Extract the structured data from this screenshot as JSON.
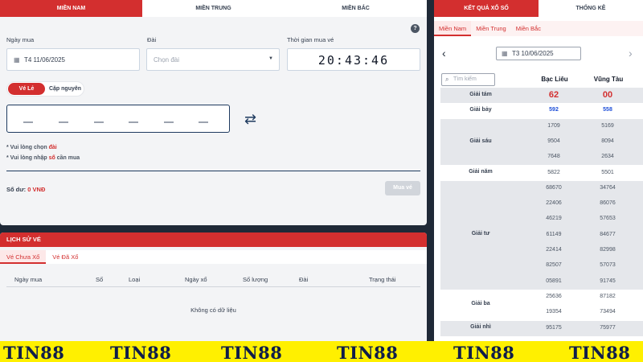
{
  "region_tabs": [
    "MIỀN NAM",
    "MIỀN TRUNG",
    "MIỀN BẮC"
  ],
  "form": {
    "date_label": "Ngày mua",
    "date_value": "T4 11/06/2025",
    "dai_label": "Đài",
    "dai_placeholder": "Chọn đài",
    "time_label": "Thời gian mua vé",
    "time_value": "20:43:46",
    "ticket_type_on": "Vé Lẻ",
    "ticket_type_off": "Cặp nguyên",
    "hint1_prefix": "* Vui lòng chọn ",
    "hint1_red": "đài",
    "hint2_prefix": "* Vui lòng nhập ",
    "hint2_red": "số",
    "hint2_suffix": " cần mua",
    "balance_label": "Số dư: ",
    "balance_value": "0 VNĐ",
    "buy_label": "Mua vé",
    "help": "?"
  },
  "history": {
    "title": "LỊCH SỬ VÉ",
    "tabs": [
      "Vé Chưa Xổ",
      "Vé Đã Xổ"
    ],
    "columns": [
      "Ngày mua",
      "Số",
      "Loại",
      "Ngày xổ",
      "Số lượng",
      "Đài",
      "Trạng thái"
    ],
    "empty": "Không có dữ liệu"
  },
  "results": {
    "tabs": [
      "KẾT QUẢ XỔ SỐ",
      "THỐNG KÊ"
    ],
    "regions": [
      "Miền Nam",
      "Miền Trung",
      "Miền Bắc"
    ],
    "date": "T3 10/06/2025",
    "search_placeholder": "Tìm kiếm",
    "provinces": [
      "Bạc Liêu",
      "Vũng Tàu"
    ],
    "prizes": [
      {
        "name": "Giải tám",
        "a": [
          "62"
        ],
        "b": [
          "00"
        ]
      },
      {
        "name": "Giải bảy",
        "a": [
          "592"
        ],
        "b": [
          "558"
        ]
      },
      {
        "name": "Giải sáu",
        "a": [
          "1709",
          "9504",
          "7648"
        ],
        "b": [
          "5169",
          "8094",
          "2634"
        ]
      },
      {
        "name": "Giải năm",
        "a": [
          "5822"
        ],
        "b": [
          "5501"
        ]
      },
      {
        "name": "Giải tư",
        "a": [
          "68670",
          "22406",
          "46219",
          "61149",
          "22414",
          "82507",
          "05891"
        ],
        "b": [
          "34764",
          "86076",
          "57653",
          "84677",
          "82998",
          "57073",
          "91745"
        ]
      },
      {
        "name": "Giải ba",
        "a": [
          "25636",
          "19354"
        ],
        "b": [
          "87182",
          "73494"
        ]
      },
      {
        "name": "Giải nhì",
        "a": [
          "95175"
        ],
        "b": [
          "75977"
        ]
      }
    ]
  },
  "footer": {
    "brand": "TIN88"
  }
}
